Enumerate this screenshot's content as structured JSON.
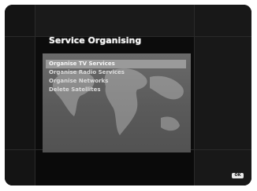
{
  "screen": {
    "title": "Service Organising",
    "menu": {
      "items": [
        {
          "label": "Organise TV Services",
          "selected": true
        },
        {
          "label": "Organise Radio Services",
          "selected": false
        },
        {
          "label": "Organise Networks",
          "selected": false
        },
        {
          "label": "Delete Satellites",
          "selected": false
        }
      ]
    },
    "footer": {
      "ok_badge_label": "OK"
    }
  },
  "colors": {
    "background": "#0c0c0c",
    "panel": "#5a5a5a",
    "selection": "#9a9a9a",
    "text": "#f4f4f4"
  }
}
